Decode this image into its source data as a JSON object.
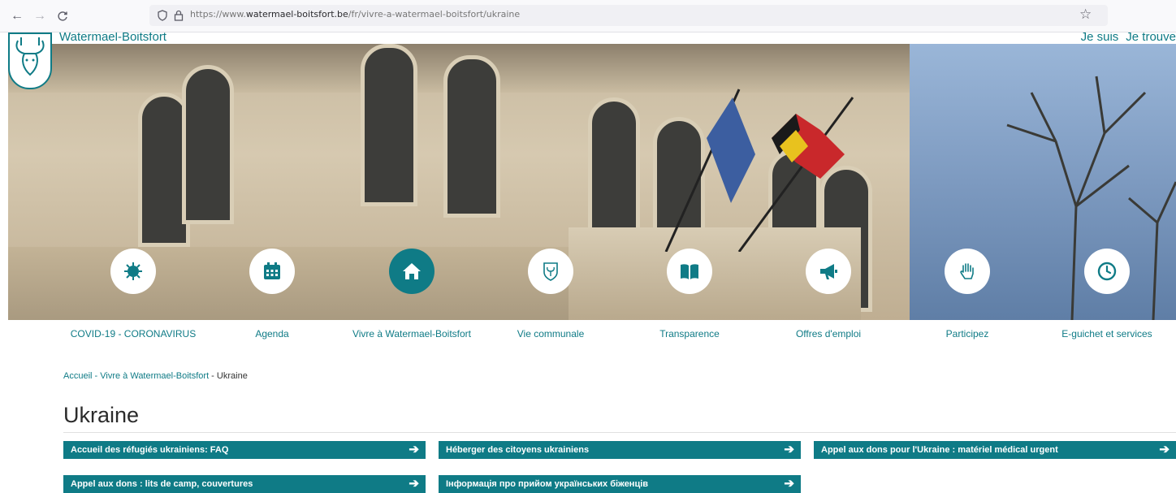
{
  "browser": {
    "url_prefix": "https://www.",
    "url_domain": "watermael-boitsfort.be",
    "url_path": "/fr/vivre-a-watermael-boitsfort/ukraine",
    "back_icon": "←",
    "forward_icon": "→",
    "reload_icon": "C",
    "shield_icon": "◯",
    "lock_icon": "🔒︎",
    "bookmark_icon": "☆"
  },
  "header": {
    "site_name": "Watermael-Boitsfort",
    "links": [
      "Je suis",
      "Je trouve"
    ]
  },
  "categories": [
    {
      "label": "COVID-19 - CORONAVIRUS",
      "icon": "virus-icon",
      "active": false
    },
    {
      "label": "Agenda",
      "icon": "calendar-icon",
      "active": false
    },
    {
      "label": "Vivre à Watermael-Boitsfort",
      "icon": "home-icon",
      "active": true
    },
    {
      "label": "Vie communale",
      "icon": "crest-icon",
      "active": false
    },
    {
      "label": "Transparence",
      "icon": "book-icon",
      "active": false
    },
    {
      "label": "Offres d'emploi",
      "icon": "megaphone-icon",
      "active": false
    },
    {
      "label": "Participez",
      "icon": "hand-icon",
      "active": false
    },
    {
      "label": "E-guichet et services",
      "icon": "clock-icon",
      "active": false
    }
  ],
  "breadcrumb": {
    "home": "Accueil",
    "separator": " - ",
    "parent": "Vivre à Watermael-Boitsfort",
    "current": "Ukraine"
  },
  "page": {
    "title": "Ukraine"
  },
  "links": [
    {
      "label": "Accueil des réfugiés ukrainiens: FAQ"
    },
    {
      "label": "Héberger des citoyens ukrainiens"
    },
    {
      "label": "Appel aux dons pour l'Ukraine : matériel médical urgent"
    },
    {
      "label": "Appel aux dons : lits de camp, couvertures"
    },
    {
      "label": "Інформація про прийом українських біженців"
    }
  ],
  "colors": {
    "accent": "#0f7b86",
    "text": "#222222"
  }
}
